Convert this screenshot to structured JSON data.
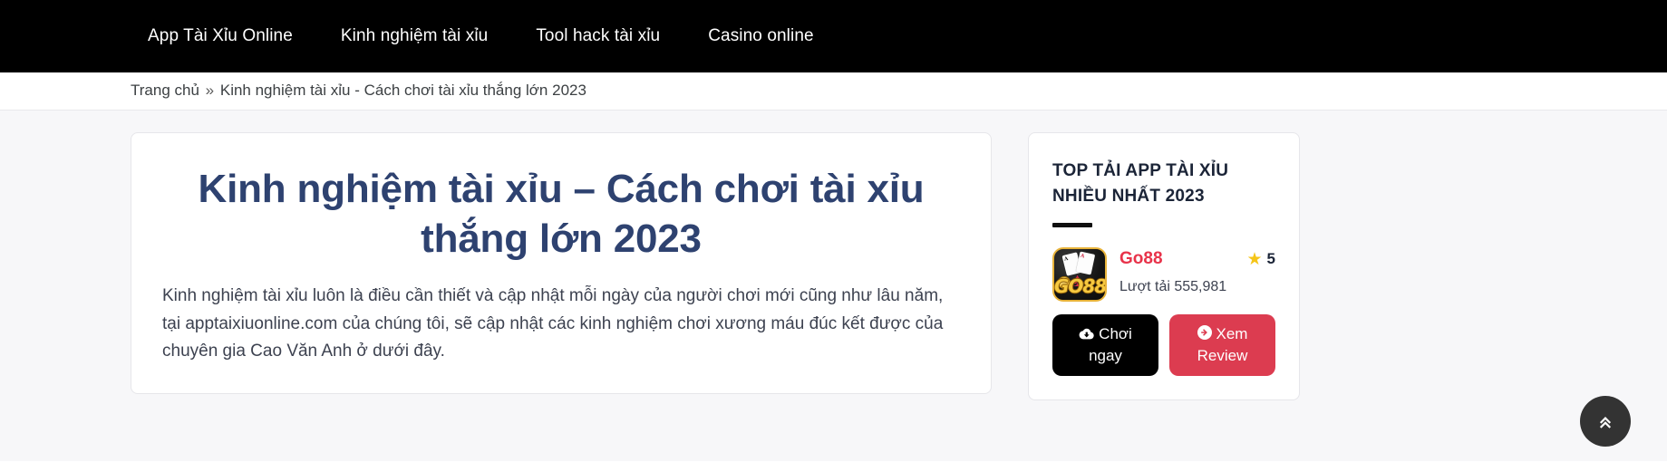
{
  "nav": {
    "items": [
      {
        "label": "App Tài Xỉu Online",
        "name": "nav-item-app-tai-xiu-online"
      },
      {
        "label": "Kinh nghiệm tài xỉu",
        "name": "nav-item-kinh-nghiem-tai-xiu"
      },
      {
        "label": "Tool hack tài xỉu",
        "name": "nav-item-tool-hack-tai-xiu"
      },
      {
        "label": "Casino online",
        "name": "nav-item-casino-online"
      }
    ]
  },
  "breadcrumb": {
    "home": "Trang chủ",
    "separator": "»",
    "current": "Kinh nghiệm tài xỉu - Cách chơi tài xỉu thắng lớn 2023"
  },
  "article": {
    "title": "Kinh nghiệm tài xỉu – Cách chơi tài xỉu thắng lớn 2023",
    "intro": "Kinh nghiệm tài xỉu luôn là điều cần thiết và cập nhật mỗi ngày của người chơi mới cũng như lâu năm, tại apptaixiuonline.com của chúng tôi, sẽ cập nhật các kinh nghiệm chơi xương máu đúc kết được của chuyên gia Cao Văn Anh ở dưới đây."
  },
  "sidebar": {
    "widget_title": "TOP TẢI APP TÀI XỈU NHIỀU NHẤT 2023",
    "apps": [
      {
        "name": "Go88",
        "logo_text": "GO88",
        "logo_card_back_pip": "A",
        "logo_card_front_pip": "A",
        "rating": "5",
        "star_icon": "star-icon",
        "downloads": "Lượt tải 555,981",
        "play_button": "Chơi ngay",
        "play_button_icon": "cloud-download-icon",
        "review_button": "Xem Review",
        "review_button_icon": "arrow-circle-right-icon"
      }
    ]
  },
  "scroll_top": {
    "icon": "double-chevron-up-icon",
    "label": ""
  },
  "colors": {
    "nav_background": "#000000",
    "title": "#2e4270",
    "accent_red": "#e8334a",
    "review_button": "#dc3c50",
    "star": "#f5c518",
    "page_background": "#f7f7f9"
  }
}
